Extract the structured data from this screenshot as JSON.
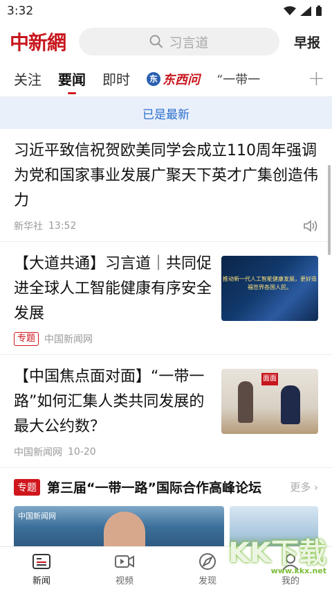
{
  "status": {
    "time": "3:32"
  },
  "header": {
    "logo_text": "中新網",
    "search_placeholder": "习言道",
    "morning_label": "早报"
  },
  "tabs": [
    {
      "label": "关注"
    },
    {
      "label": "要闻",
      "active": true
    },
    {
      "label": "即时"
    },
    {
      "label": "东西问",
      "badge": "东"
    },
    {
      "label": "“一带一"
    }
  ],
  "notice": "已是最新",
  "articles": [
    {
      "title": "习近平致信祝贺欧美同学会成立110周年强调 为党和国家事业发展广聚天下英才广集创造伟力",
      "source": "新华社",
      "time": "13:52"
    },
    {
      "title": "【大道共通】习言道｜共同促进全球人工智能健康有序安全发展",
      "tag": "专题",
      "source": "中国新闻网",
      "thumb_caption": "推动新一代人工智能健康发展，更好造福世界各国人民。"
    },
    {
      "title": "【中国焦点面对面】“一带一路”如何汇集人类共同发展的最大公约数？",
      "source": "中国新闻网",
      "time": "10-20",
      "thumb_logo": "面面"
    }
  ],
  "special": {
    "badge": "专题",
    "title": "第三届“一带一路”国际合作高峰论坛",
    "more": "更多",
    "card_label": "中国新闻网"
  },
  "tabbar": [
    {
      "label": "新闻",
      "icon": "news-icon",
      "active": true
    },
    {
      "label": "视频",
      "icon": "video-icon"
    },
    {
      "label": "发现",
      "icon": "discover-icon"
    },
    {
      "label": "我的",
      "icon": "profile-icon"
    }
  ],
  "watermark": {
    "text": "KK下载",
    "sub": "www.kkx.net"
  },
  "colors": {
    "brand_red": "#c8161d",
    "notice_bg": "#e9f0fa",
    "notice_text": "#2c6fce"
  }
}
